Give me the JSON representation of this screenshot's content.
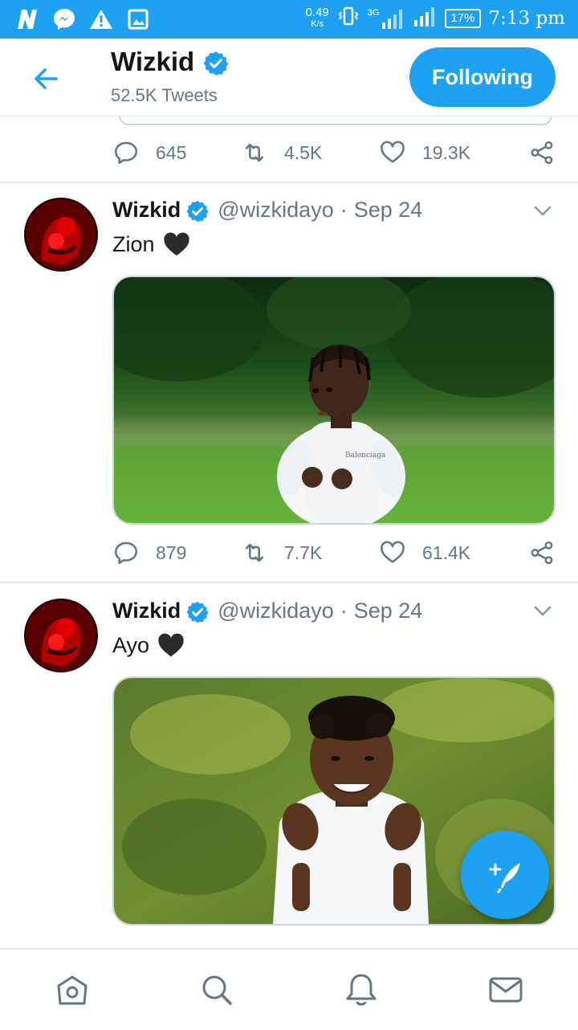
{
  "status_bar": {
    "speed_value": "0.49",
    "speed_unit": "K/s",
    "network": "3G",
    "battery": "17%",
    "time": "7:13 pm"
  },
  "header": {
    "name": "Wizkid",
    "tweet_count": "52.5K Tweets",
    "follow_label": "Following"
  },
  "colors": {
    "accent": "#1da1f2",
    "muted": "#657786"
  },
  "partial_tweet": {
    "replies": "645",
    "retweets": "4.5K",
    "likes": "19.3K"
  },
  "tweets": [
    {
      "name": "Wizkid",
      "handle": "@wizkidayo",
      "separator": "·",
      "date": "Sep 24",
      "text": "Zion",
      "replies": "879",
      "retweets": "7.7K",
      "likes": "61.4K",
      "shirt_text": "Balenciaga"
    },
    {
      "name": "Wizkid",
      "handle": "@wizkidayo",
      "separator": "·",
      "date": "Sep 24",
      "text": "Ayo"
    }
  ],
  "icons": {
    "back": "arrow-left-icon",
    "verified": "verified-badge-icon",
    "reply": "reply-icon",
    "retweet": "retweet-icon",
    "like": "heart-outline-icon",
    "share": "share-icon",
    "compose": "compose-tweet-icon",
    "home": "home-icon",
    "search": "search-icon",
    "notifications": "bell-icon",
    "messages": "mail-icon"
  }
}
